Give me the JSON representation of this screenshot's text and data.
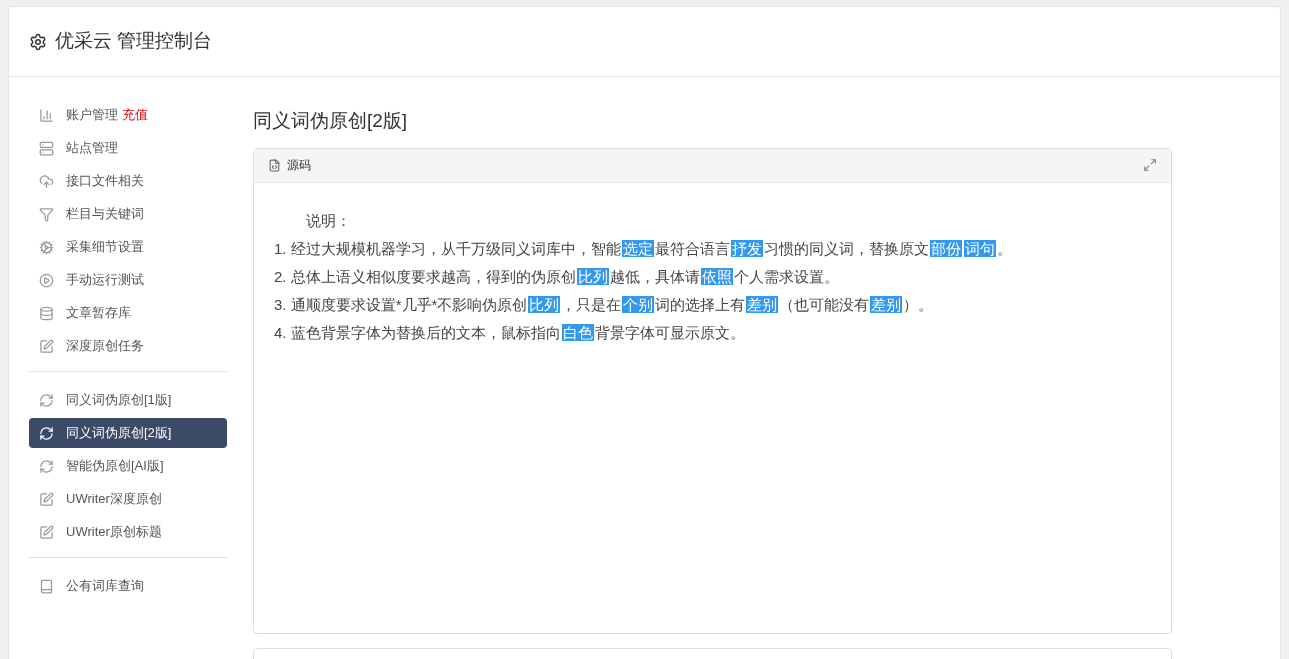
{
  "header": {
    "title": "优采云 管理控制台"
  },
  "sidebar": {
    "groups": [
      {
        "items": [
          {
            "label": "账户管理",
            "badge": "充值",
            "selected": false
          },
          {
            "label": "站点管理",
            "selected": false
          },
          {
            "label": "接口文件相关",
            "selected": false
          },
          {
            "label": "栏目与关键词",
            "selected": false
          },
          {
            "label": "采集细节设置",
            "selected": false
          },
          {
            "label": "手动运行测试",
            "selected": false
          },
          {
            "label": "文章暂存库",
            "selected": false
          },
          {
            "label": "深度原创任务",
            "selected": false
          }
        ]
      },
      {
        "items": [
          {
            "label": "同义词伪原创[1版]",
            "selected": false
          },
          {
            "label": "同义词伪原创[2版]",
            "selected": true
          },
          {
            "label": "智能伪原创[AI版]",
            "selected": false
          },
          {
            "label": "UWriter深度原创",
            "selected": false
          },
          {
            "label": "UWriter原创标题",
            "selected": false
          }
        ]
      },
      {
        "items": [
          {
            "label": "公有词库查询",
            "selected": false
          }
        ]
      }
    ]
  },
  "main": {
    "title": "同义词伪原创[2版]",
    "panel": {
      "title": "源码",
      "heading": "说明：",
      "lines": [
        [
          {
            "text": "1. 经过大规模机器学习，从千万级同义词库中，智能",
            "highlighted": false
          },
          {
            "text": "选定",
            "highlighted": true
          },
          {
            "text": "最符合语言",
            "highlighted": false
          },
          {
            "text": "抒发",
            "highlighted": true
          },
          {
            "text": "习惯的同义词，替换原文",
            "highlighted": false
          },
          {
            "text": "部份",
            "highlighted": true
          },
          {
            "text": "词句",
            "highlighted": true
          },
          {
            "text": "。",
            "highlighted": false
          }
        ],
        [
          {
            "text": "2. 总体上语义相似度要求越高，得到的伪原创",
            "highlighted": false
          },
          {
            "text": "比列",
            "highlighted": true
          },
          {
            "text": "越低，具体请",
            "highlighted": false
          },
          {
            "text": "依照",
            "highlighted": true
          },
          {
            "text": "个人需求设置。",
            "highlighted": false
          }
        ],
        [
          {
            "text": "3. 通顺度要求设置*几乎*不影响伪原创",
            "highlighted": false
          },
          {
            "text": "比列",
            "highlighted": true
          },
          {
            "text": "，只是在",
            "highlighted": false
          },
          {
            "text": "个别",
            "highlighted": true
          },
          {
            "text": "词的选择上有",
            "highlighted": false
          },
          {
            "text": "差别",
            "highlighted": true
          },
          {
            "text": "（也可能没有",
            "highlighted": false
          },
          {
            "text": "差别",
            "highlighted": true
          },
          {
            "text": "）。",
            "highlighted": false
          }
        ],
        [
          {
            "text": "4. 蓝色背景字体为替换后的文本，鼠标指向",
            "highlighted": false
          },
          {
            "text": "白色",
            "highlighted": true
          },
          {
            "text": "背景字体可显示原文。",
            "highlighted": false
          }
        ]
      ]
    }
  }
}
